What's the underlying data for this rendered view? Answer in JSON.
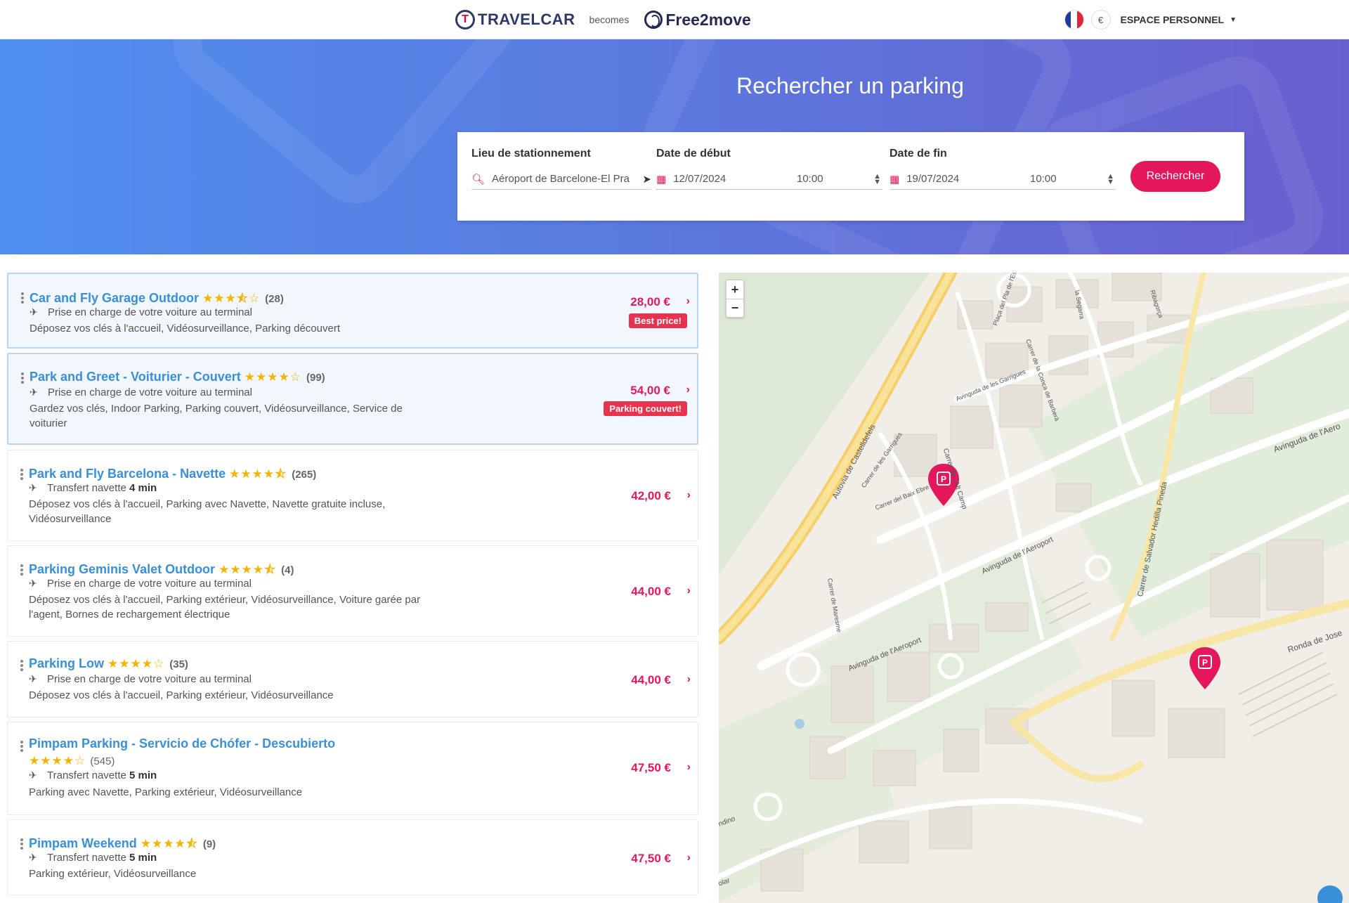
{
  "header": {
    "brand_travelcar": "TRAVELCAR",
    "brand_becomes": "becomes",
    "brand_free2move": "Free2move",
    "currency": "€",
    "account_label": "ESPACE PERSONNEL"
  },
  "hero": {
    "title": "Rechercher un parking"
  },
  "search": {
    "location_label": "Lieu de stationnement",
    "location_value": "Aéroport de Barcelone-El Pra",
    "start_label": "Date de début",
    "start_date": "12/07/2024",
    "start_time": "10:00",
    "end_label": "Date de fin",
    "end_date": "19/07/2024",
    "end_time": "10:00",
    "button_label": "Rechercher"
  },
  "results": [
    {
      "title": "Car and Fly Garage Outdoor",
      "rating": 3.5,
      "reviews": "(28)",
      "transfer_text": "Prise en charge de votre voiture au terminal",
      "transfer_bold": "",
      "description": "Déposez vos clés à l'accueil, Vidéosurveillance, Parking découvert",
      "price": "28,00 €",
      "badge": "Best price!"
    },
    {
      "title": "Park and Greet - Voiturier - Couvert",
      "rating": 4,
      "reviews": "(99)",
      "transfer_text": "Prise en charge de votre voiture au terminal",
      "transfer_bold": "",
      "description": "Gardez vos clés, Indoor Parking, Parking couvert, Vidéosurveillance, Service de voiturier",
      "price": "54,00 €",
      "badge": "Parking couvert!"
    },
    {
      "title": "Park and Fly Barcelona - Navette",
      "rating": 4.5,
      "reviews": "(265)",
      "transfer_text": "Transfert navette",
      "transfer_bold": "4 min",
      "description": "Déposez vos clés à l'accueil, Parking avec Navette, Navette gratuite incluse, Vidéosurveillance",
      "price": "42,00 €",
      "badge": ""
    },
    {
      "title": "Parking Geminis Valet Outdoor",
      "rating": 4.5,
      "reviews": "(4)",
      "transfer_text": "Prise en charge de votre voiture au terminal",
      "transfer_bold": "",
      "description": "Déposez vos clés à l'accueil, Parking extérieur, Vidéosurveillance, Voiture garée par l'agent, Bornes de rechargement électrique",
      "price": "44,00 €",
      "badge": ""
    },
    {
      "title": "Parking Low",
      "rating": 4,
      "reviews": "(35)",
      "transfer_text": "Prise en charge de votre voiture au terminal",
      "transfer_bold": "",
      "description": "Déposez vos clés à l'accueil, Parking extérieur, Vidéosurveillance",
      "price": "44,00 €",
      "badge": ""
    },
    {
      "title": "Pimpam Parking - Servicio de Chófer - Descubierto",
      "rating": 4,
      "reviews": "(545)",
      "transfer_text": "Transfert navette",
      "transfer_bold": "5 min",
      "description": "Parking avec Navette, Parking extérieur, Vidéosurveillance",
      "price": "47,50 €",
      "badge": ""
    },
    {
      "title": "Pimpam Weekend",
      "rating": 4.5,
      "reviews": "(9)",
      "transfer_text": "Transfert navette",
      "transfer_bold": "5 min",
      "description": "Parking extérieur, Vidéosurveillance",
      "price": "47,50 €",
      "badge": ""
    }
  ],
  "map": {
    "zoom_in": "+",
    "zoom_out": "−",
    "streets": [
      "Autovia de Castelldefels",
      "Carrer de les Garrigues",
      "Avinguda de les Garrigues",
      "Carrer de l'Alt Camp",
      "Carrer del Baix Ebre",
      "Carrer de la Conca de Barberà",
      "Avinguda de l'Aeroport",
      "Carrer de Maresme",
      "Carrer de Salvador Hedilla Pineda",
      "Ronda de Jose",
      "Avinguda de l'Aero",
      "Plaça del Pla de l'Estany",
      "la Segarra",
      "Ribagorça",
      "ndino",
      "olar"
    ],
    "marker_letter": "P",
    "accent_color": "#e5175c"
  }
}
